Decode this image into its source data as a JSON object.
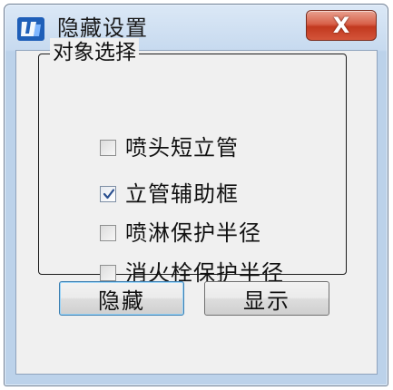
{
  "window": {
    "title": "隐藏设置",
    "close_glyph": "X",
    "app_icon": "blue-logo-icon"
  },
  "group": {
    "legend": "对象选择",
    "items": [
      {
        "label": "喷头短立管",
        "checked": false
      },
      {
        "label": "立管辅助框",
        "checked": true
      },
      {
        "label": "喷淋保护半径",
        "checked": false
      },
      {
        "label": "消火栓保护半径",
        "checked": false
      }
    ]
  },
  "buttons": {
    "hide_label": "隐藏",
    "show_label": "显示"
  },
  "colors": {
    "titlebar": "#c7daef",
    "close_button": "#c2391f",
    "client_bg": "#f0f0f0",
    "check_mark": "#2a4f8f"
  }
}
